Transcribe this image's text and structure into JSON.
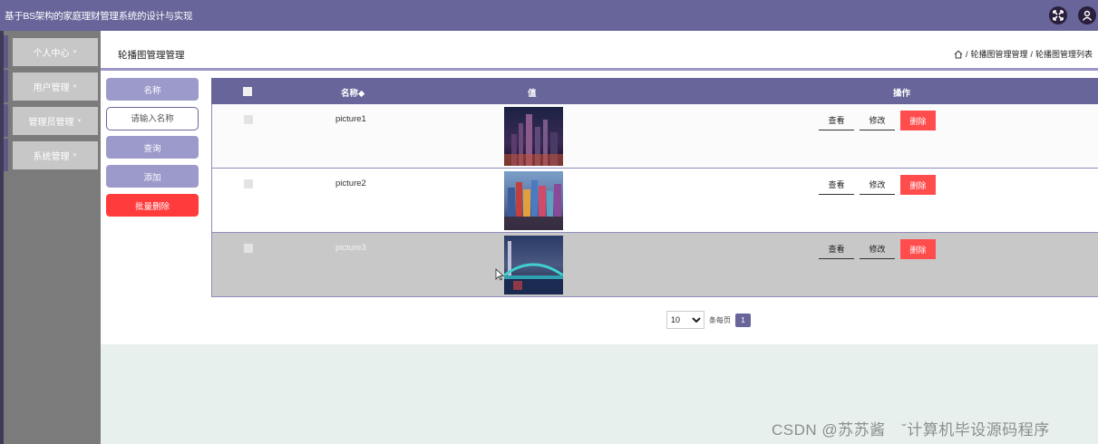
{
  "app": {
    "title": "基于BS架构的家庭理财管理系统的设计与实现"
  },
  "header_icons": [
    "fullscreen-icon",
    "user-icon"
  ],
  "sidebar": {
    "items": [
      {
        "label": "个人中心"
      },
      {
        "label": "用户管理"
      },
      {
        "label": "管理员管理"
      },
      {
        "label": "系统管理"
      }
    ]
  },
  "page": {
    "title": "轮播图管理管理",
    "breadcrumb": [
      "轮播图管理管理",
      "轮播图管理列表"
    ],
    "breadcrumb_sep": "/"
  },
  "filter": {
    "name_label": "名称",
    "name_placeholder": "请输入名称",
    "search_label": "查询",
    "add_label": "添加",
    "batch_delete_label": "批量删除"
  },
  "table": {
    "columns": [
      "名称◆",
      "值",
      "操作"
    ],
    "rows": [
      {
        "name": "picture1",
        "image": "city-night-skyline"
      },
      {
        "name": "picture2",
        "image": "colorful-harbor-buildings"
      },
      {
        "name": "picture3",
        "image": "illuminated-bridge"
      }
    ],
    "actions": {
      "view": "查看",
      "edit": "修改",
      "delete": "删除"
    }
  },
  "pagination": {
    "page_size": "10",
    "page_size_options": [
      "10"
    ],
    "per_page_label": "条每页",
    "current_page": "1"
  },
  "watermark": "CSDN @苏苏酱　ˇ计算机毕设源码程序",
  "colors": {
    "primary": "#67659a",
    "primary_light": "#9c9acb",
    "danger": "#ff4d4d",
    "sidebar_bg": "#7b7b7b"
  }
}
